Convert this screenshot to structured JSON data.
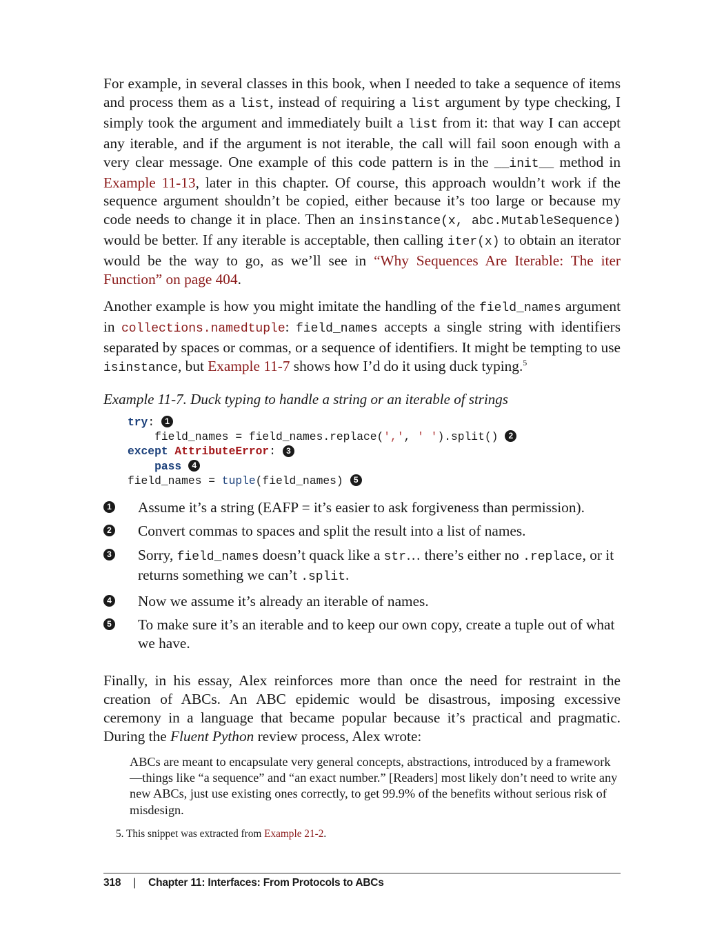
{
  "para1": {
    "t1": "For example, in several classes in this book, when I needed to take a sequence of items and process them as a ",
    "c1": "list",
    "t2": ", instead of requiring a ",
    "c2": "list",
    "t3": " argument by type checking, I simply took the argument and immediately built a ",
    "c3": "list",
    "t4": " from it: that way I can accept any iterable, and if the argument is not iterable, the call will fail soon enough with a very clear message. One example of this code pattern is in the ",
    "c4": "__init__",
    "t5": " method in ",
    "link1": "Example 11-13",
    "t6": ", later in this chapter. Of course, this approach wouldn’t work if the sequence argument shouldn’t be copied, either because it’s too large or because my code needs to change it in place. Then an ",
    "c5": "insinstance(x, abc.MutableSequence)",
    "t7": " would be better. If any iterable is acceptable, then calling ",
    "c6": "iter(x)",
    "t8": " to obtain an iterator would be the way to go, as we’ll see in ",
    "link2": "“Why Sequences Are Iterable: The iter Function” on page 404",
    "t9": "."
  },
  "para2": {
    "t1": "Another example is how you might imitate the handling of the ",
    "c1": "field_names",
    "t2": " argument in ",
    "link1": "collections.namedtuple",
    "t3": ": ",
    "c2": "field_names",
    "t4": " accepts a single string with identifiers separated by spaces or commas, or a sequence of identifiers. It might be tempting to use ",
    "c3": "isinstance",
    "t5": ", but ",
    "link2": "Example 11-7",
    "t6": " shows how I’d do it using duck typing.",
    "fn": "5"
  },
  "example": {
    "title": "Example 11-7. Duck typing to handle a string or an iterable of strings",
    "code": {
      "l1_kw": "try",
      "l1_p": ":",
      "l2_a": "    field_names = field_names.replace(",
      "l2_s1": "','",
      "l2_c": ", ",
      "l2_s2": "' '",
      "l2_b": ").split()",
      "l3_kw": "except",
      "l3_cls": "AttributeError",
      "l3_p": ":",
      "l4_kw": "pass",
      "l5_a": "field_names = ",
      "l5_bi": "tuple",
      "l5_b": "(field_names)"
    },
    "badges": [
      "1",
      "2",
      "3",
      "4",
      "5"
    ]
  },
  "callouts": {
    "c1": "Assume it’s a string (EAFP = it’s easier to ask forgiveness than permission).",
    "c2": "Convert commas to spaces and split the result into a list of names.",
    "c3_t1": "Sorry, ",
    "c3_m1": "field_names",
    "c3_t2": " doesn’t quack like a ",
    "c3_m2": "str",
    "c3_t3": "… there’s either no ",
    "c3_m3": ".replace",
    "c3_t4": ", or it returns something we can’t ",
    "c3_m4": ".split",
    "c3_t5": ".",
    "c4": "Now we assume it’s already an iterable of names.",
    "c5": "To make sure it’s an iterable and to keep our own copy, create a tuple out of what we have."
  },
  "para3": {
    "t1": "Finally, in his essay, Alex reinforces more than once the need for restraint in the creation of ABCs. An ABC epidemic would be disastrous, imposing excessive ceremony in a language that became popular because it’s practical and pragmatic. During the ",
    "em": "Fluent Python",
    "t2": " review process, Alex wrote:"
  },
  "quote": "ABCs are meant to encapsulate very general concepts, abstractions, introduced by a framework—things like “a sequence” and “an exact number.” [Readers] most likely don’t need to write any new ABCs, just use existing ones correctly, to get 99.9% of the benefits without serious risk of misdesign.",
  "footnote": {
    "num": "5.",
    "t1": " This snippet was extracted from ",
    "link": "Example 21-2",
    "t2": "."
  },
  "footer": {
    "page": "318",
    "sep": "|",
    "chapter": "Chapter 11: Interfaces: From Protocols to ABCs"
  }
}
